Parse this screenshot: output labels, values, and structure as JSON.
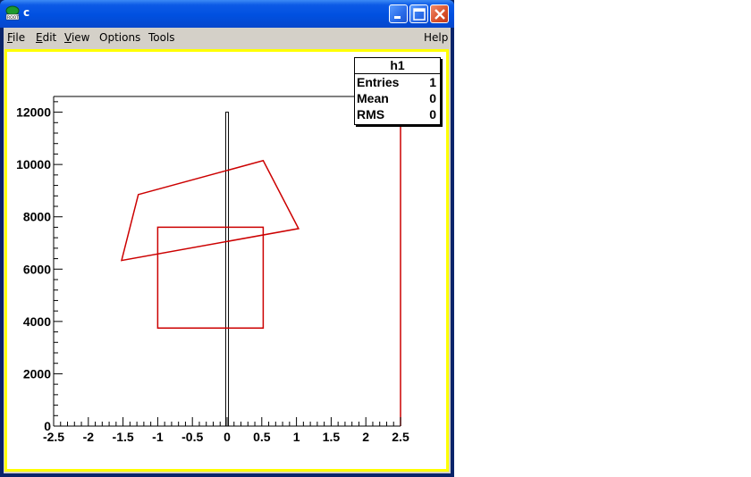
{
  "window": {
    "title": "c"
  },
  "menubar": {
    "items": [
      {
        "pre": "",
        "u": "F",
        "post": "ile"
      },
      {
        "pre": "",
        "u": "E",
        "post": "dit"
      },
      {
        "pre": "",
        "u": "V",
        "post": "iew"
      },
      {
        "pre": "Options",
        "u": "",
        "post": ""
      },
      {
        "pre": "Tools",
        "u": "",
        "post": ""
      }
    ],
    "help": "Help"
  },
  "stats": {
    "title": "h1",
    "rows": [
      {
        "label": "Entries",
        "value": "1"
      },
      {
        "label": "Mean",
        "value": "0"
      },
      {
        "label": "RMS",
        "value": "0"
      }
    ]
  },
  "colors": {
    "accent": "#cc0000",
    "canvas_border": "#ffff00"
  },
  "chart_data": {
    "type": "line",
    "xlim": [
      -2.5,
      2.5
    ],
    "ylim": [
      0,
      12600
    ],
    "x_ticks": [
      "-2.5",
      "-2",
      "-1.5",
      "-1",
      "-0.5",
      "0",
      "0.5",
      "1",
      "1.5",
      "2",
      "2.5"
    ],
    "x_tick_values": [
      -2.5,
      -2,
      -1.5,
      -1,
      -0.5,
      0,
      0.5,
      1,
      1.5,
      2,
      2.5
    ],
    "y_ticks": [
      "0",
      "2000",
      "4000",
      "6000",
      "8000",
      "10000",
      "12000"
    ],
    "y_tick_values": [
      0,
      2000,
      4000,
      6000,
      8000,
      10000,
      12000
    ],
    "histogram": {
      "name": "h1",
      "bin_low": -0.02,
      "bin_high": 0.02,
      "value": 12000
    },
    "shapes": [
      {
        "name": "quadrilateral",
        "points": [
          [
            -1.28,
            8850
          ],
          [
            0.52,
            10150
          ],
          [
            1.03,
            7550
          ],
          [
            -1.52,
            6330
          ]
        ]
      },
      {
        "name": "box",
        "points": [
          [
            -1.0,
            3750
          ],
          [
            0.52,
            3750
          ],
          [
            0.52,
            7600
          ],
          [
            -1.0,
            7600
          ]
        ]
      }
    ]
  }
}
